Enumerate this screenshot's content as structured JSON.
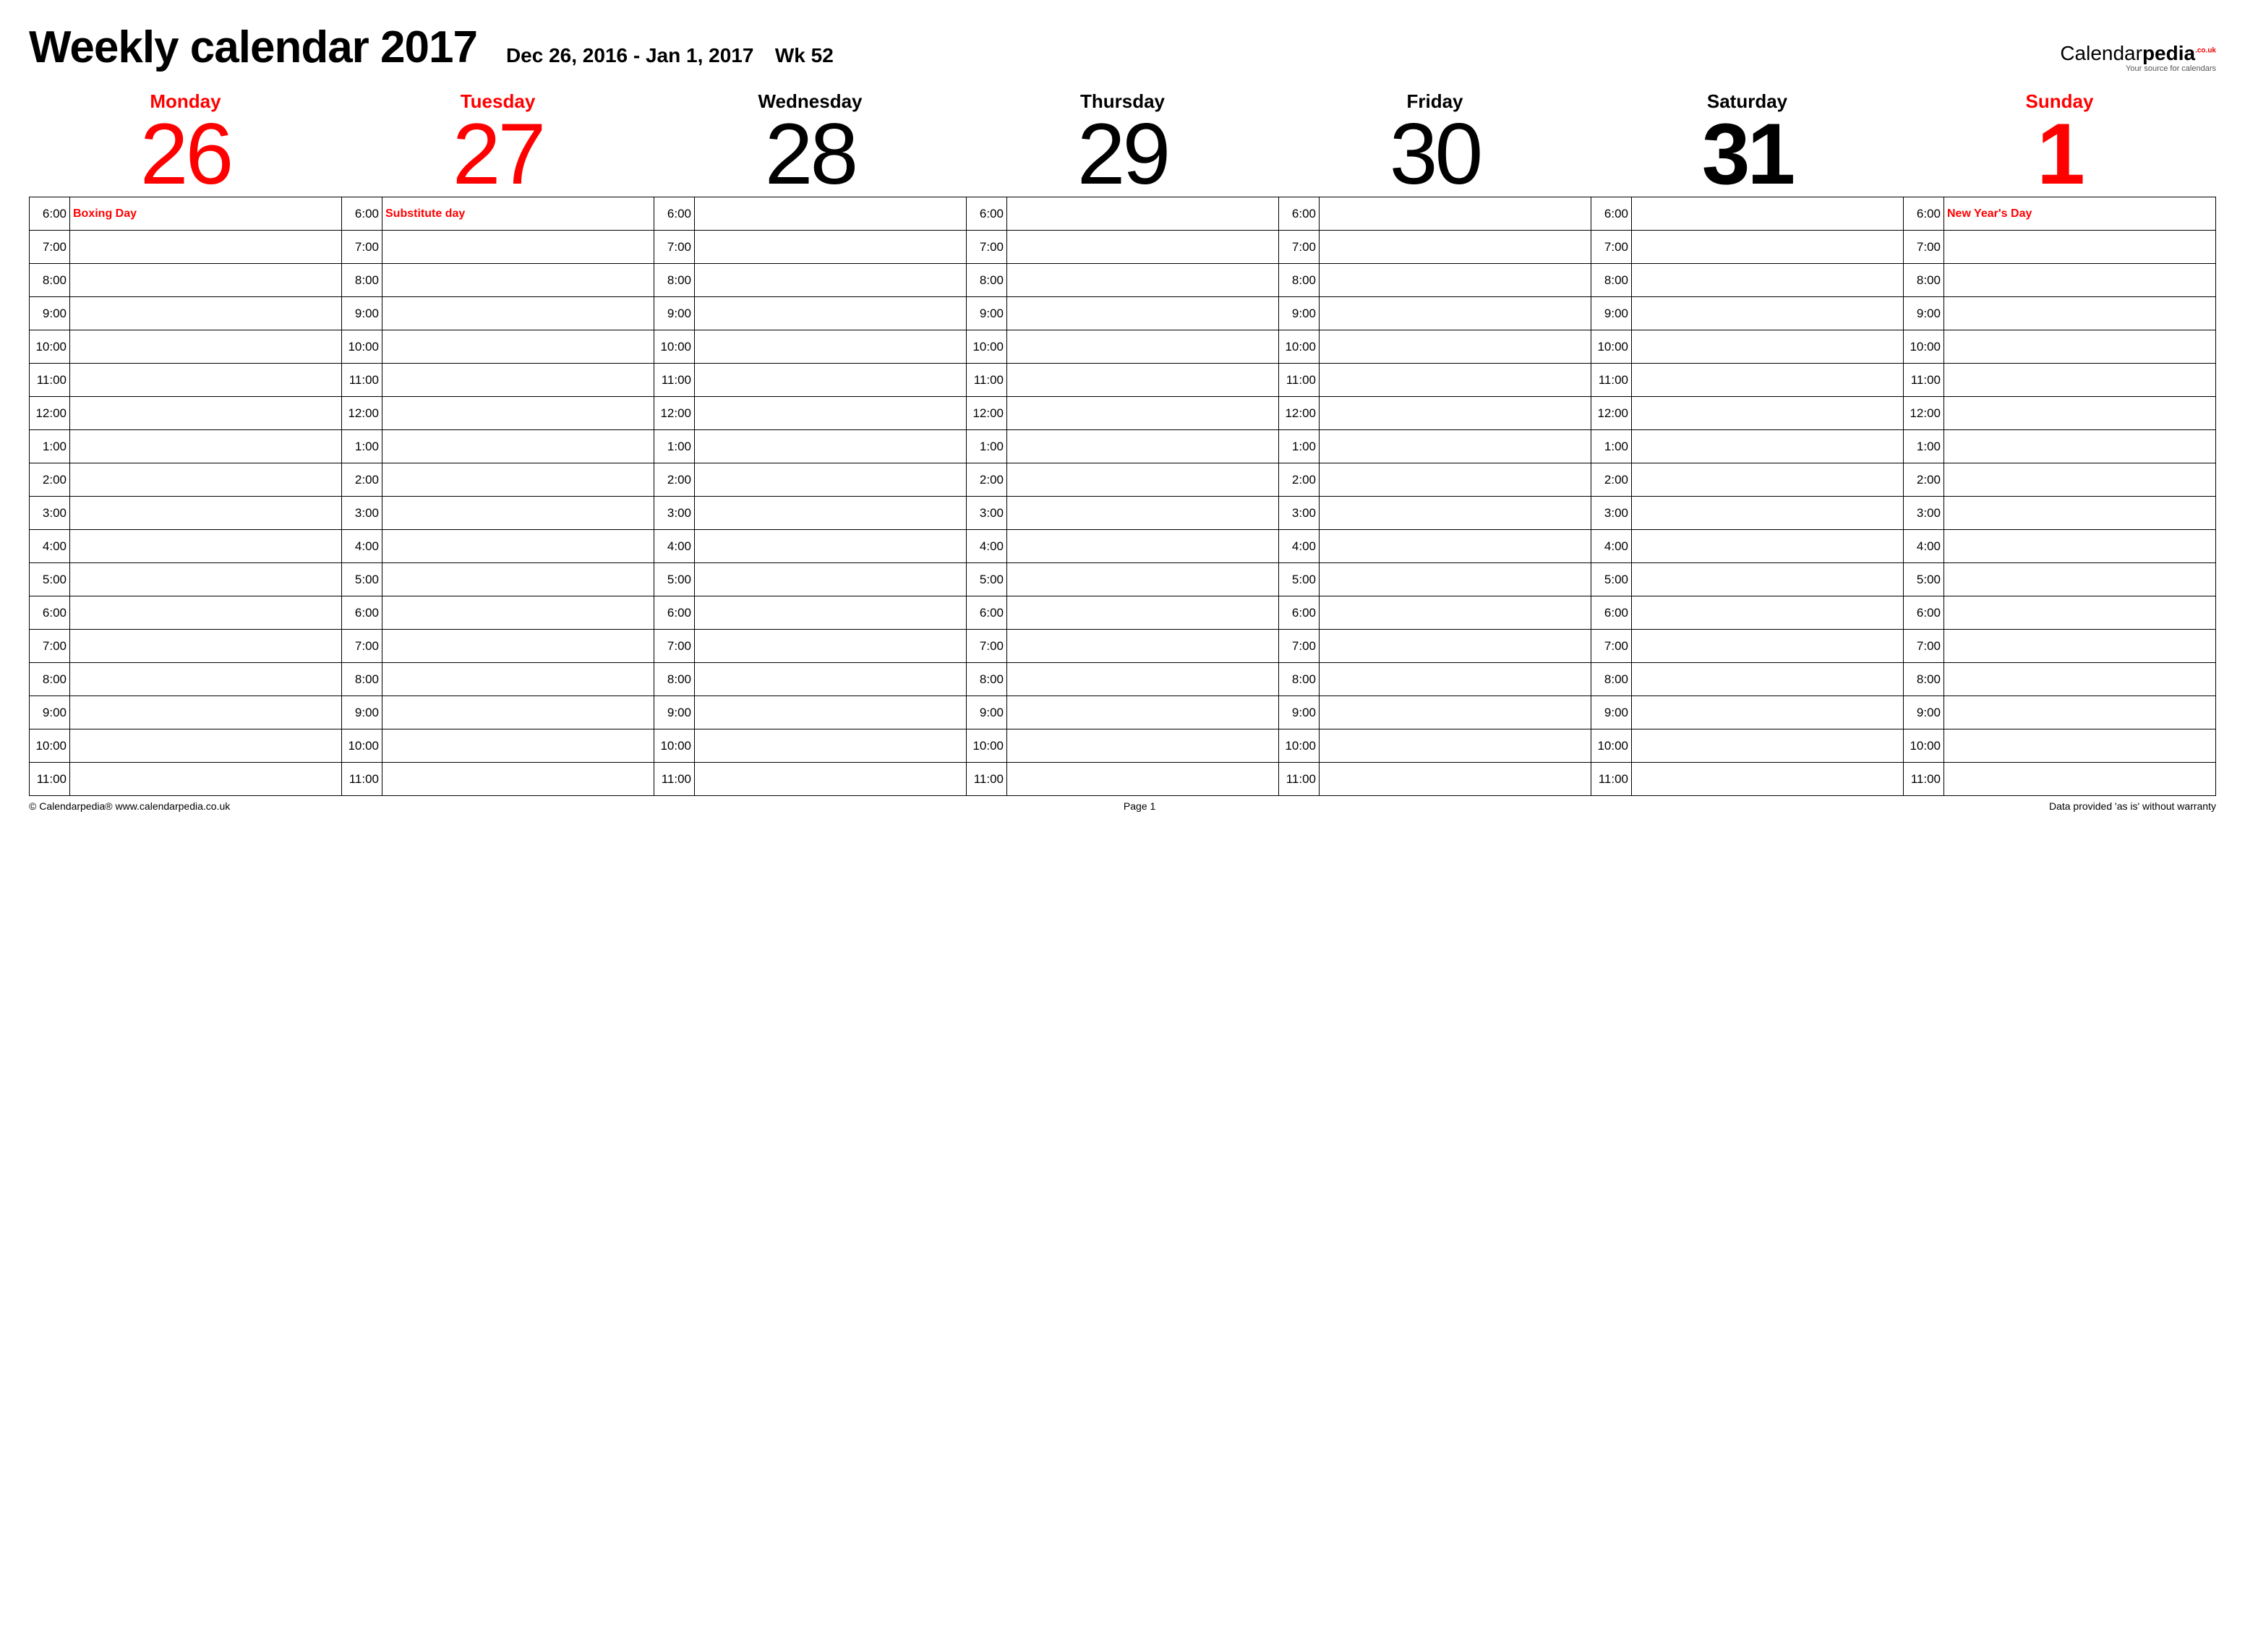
{
  "header": {
    "title": "Weekly calendar 2017",
    "date_range": "Dec 26, 2016 - Jan 1, 2017",
    "week": "Wk 52"
  },
  "brand": {
    "name1": "Calendar",
    "name2": "pedia",
    "suffix": ".co.uk",
    "tag": "Your source for calendars"
  },
  "days": [
    {
      "name": "Monday",
      "num": "26",
      "cls": "holiday",
      "event": "Boxing Day"
    },
    {
      "name": "Tuesday",
      "num": "27",
      "cls": "holiday",
      "event": "Substitute day"
    },
    {
      "name": "Wednesday",
      "num": "28",
      "cls": "",
      "event": ""
    },
    {
      "name": "Thursday",
      "num": "29",
      "cls": "",
      "event": ""
    },
    {
      "name": "Friday",
      "num": "30",
      "cls": "",
      "event": ""
    },
    {
      "name": "Saturday",
      "num": "31",
      "cls": "sat",
      "event": ""
    },
    {
      "name": "Sunday",
      "num": "1",
      "cls": "sun",
      "event": "New Year's Day"
    }
  ],
  "times": [
    "6:00",
    "7:00",
    "8:00",
    "9:00",
    "10:00",
    "11:00",
    "12:00",
    "1:00",
    "2:00",
    "3:00",
    "4:00",
    "5:00",
    "6:00",
    "7:00",
    "8:00",
    "9:00",
    "10:00",
    "11:00"
  ],
  "footer": {
    "left": "© Calendarpedia®   www.calendarpedia.co.uk",
    "center": "Page 1",
    "right": "Data provided 'as is' without warranty"
  }
}
